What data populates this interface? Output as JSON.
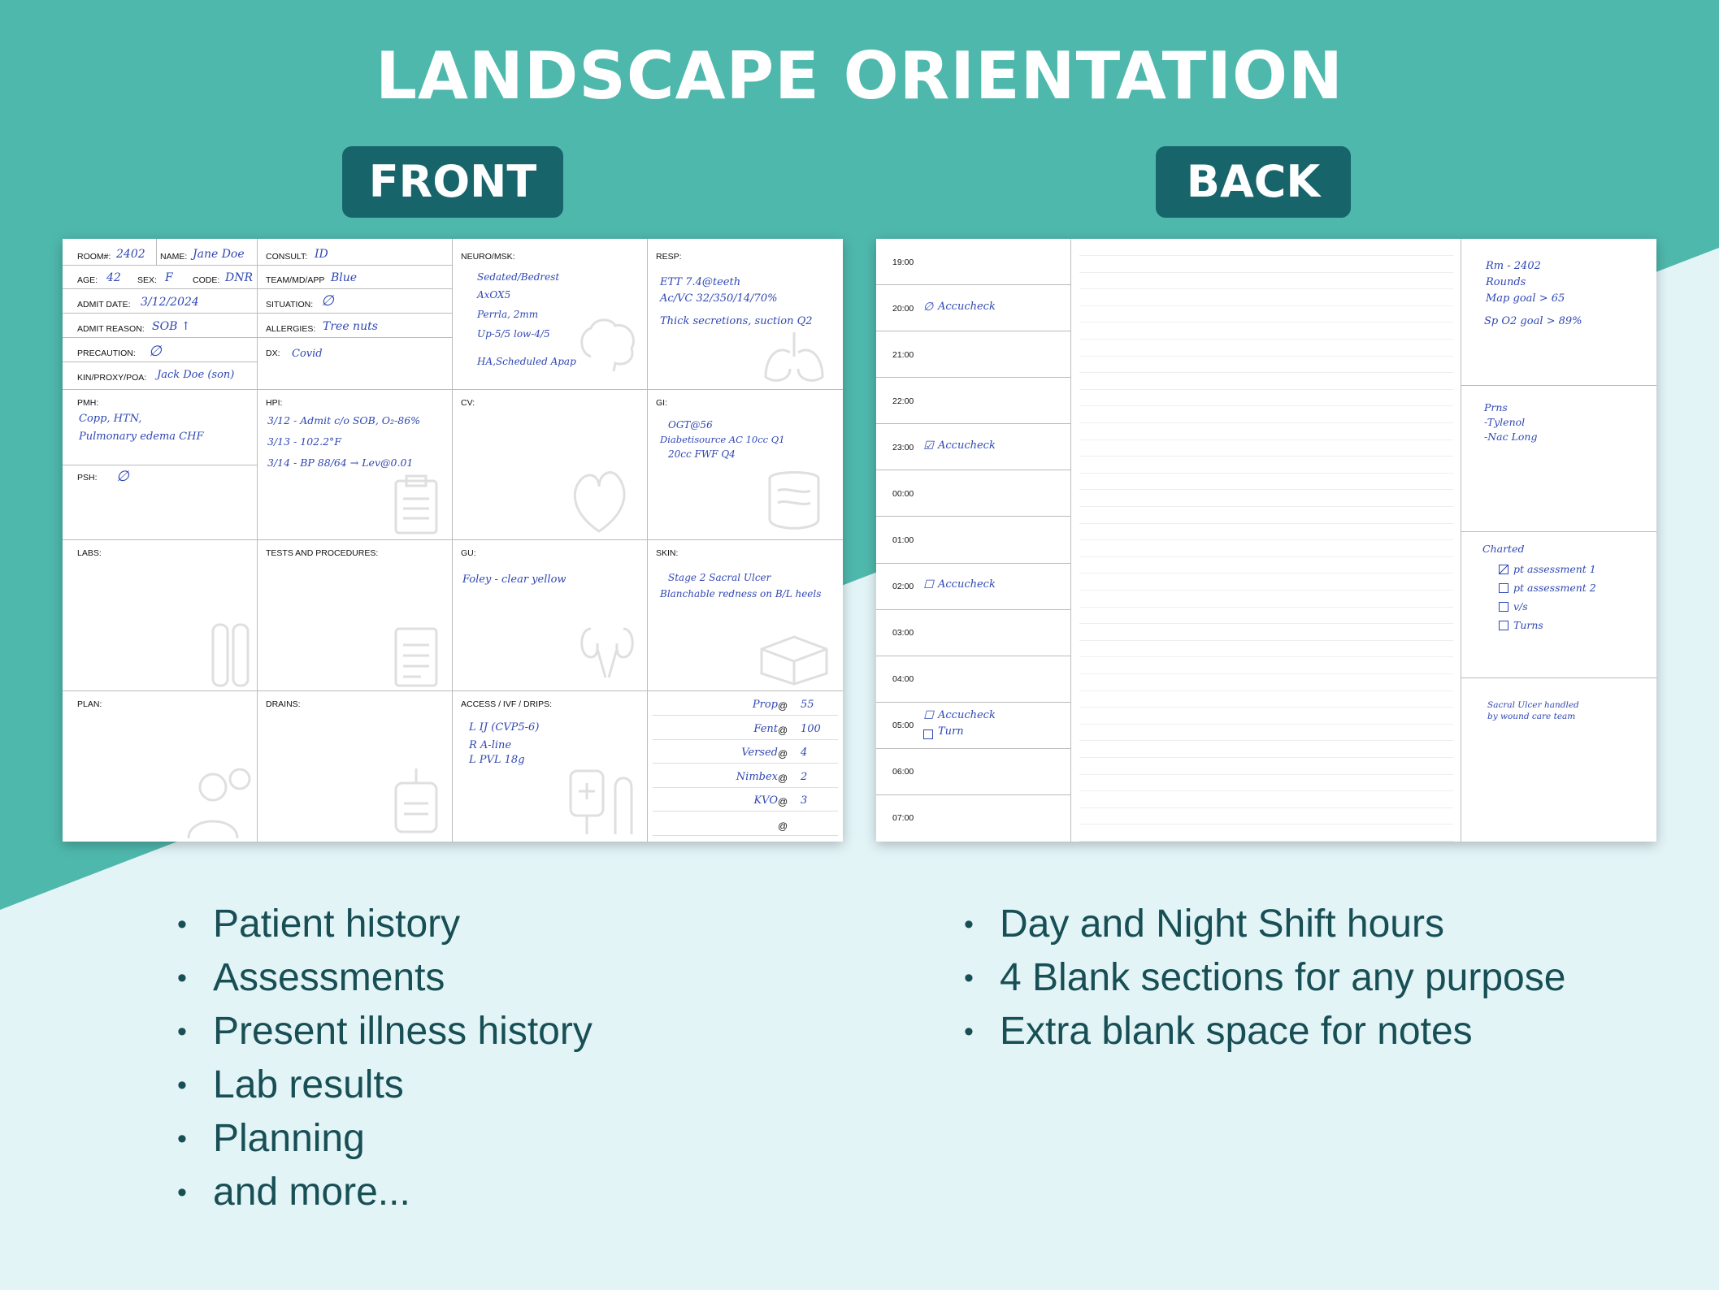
{
  "page": {
    "title": "LANDSCAPE ORIENTATION",
    "front_label": "FRONT",
    "back_label": "BACK",
    "colors": {
      "teal": "#4fb8ad",
      "dark_teal": "#17656b",
      "light_bg": "#e3f4f7",
      "ink": "#2f47b3",
      "bullet_text": "#174f55"
    }
  },
  "front": {
    "room_label": "ROOM#:",
    "room": "2402",
    "name_label": "NAME:",
    "name": "Jane Doe",
    "age_label": "AGE:",
    "age": "42",
    "sex_label": "SEX:",
    "sex": "F",
    "code_label": "CODE:",
    "code": "DNR",
    "admit_date_label": "ADMIT DATE:",
    "admit_date": "3/12/2024",
    "admit_reason_label": "ADMIT REASON:",
    "admit_reason": "SOB ↑",
    "precaution_label": "PRECAUTION:",
    "precaution": "∅",
    "kin_label": "KIN/PROXY/POA:",
    "kin": "Jack Doe (son)",
    "consult_label": "CONSULT:",
    "consult": "ID",
    "team_label": "TEAM/MD/APP",
    "team": "Blue",
    "situation_label": "SITUATION:",
    "situation": "∅",
    "allergies_label": "ALLERGIES:",
    "allergies": "Tree nuts",
    "dx_label": "DX:",
    "dx": "Covid",
    "neuro_label": "NEURO/MSK:",
    "neuro": [
      "Sedated/Bedrest",
      "AxOX5",
      "Perrla, 2mm",
      "Up-5/5  low-4/5",
      "HA,Scheduled Apap"
    ],
    "resp_label": "RESP:",
    "resp": [
      "ETT 7.4@teeth",
      "Ac/VC 32/350/14/70%",
      "Thick secretions, suction Q2"
    ],
    "pmh_label": "PMH:",
    "pmh": [
      "Copp, HTN,",
      "Pulmonary edema     CHF"
    ],
    "psh_label": "PSH:",
    "psh": "∅",
    "hpi_label": "HPI:",
    "hpi": [
      "3/12 - Admit c/o SOB, O₂-86%",
      "3/13 - 102.2°F",
      "3/14 - BP 88/64 → Lev@0.01"
    ],
    "cv_label": "CV:",
    "gi_label": "GI:",
    "gi": [
      "OGT@56",
      "Diabetisource AC 10cc Q1",
      "20cc FWF Q4"
    ],
    "labs_label": "LABS:",
    "tests_label": "TESTS AND PROCEDURES:",
    "gu_label": "GU:",
    "gu": "Foley - clear yellow",
    "skin_label": "SKIN:",
    "skin": [
      "Stage 2 Sacral Ulcer",
      "Blanchable redness on B/L heels"
    ],
    "plan_label": "PLAN:",
    "drains_label": "DRAINS:",
    "access_label": "ACCESS / IVF / DRIPS:",
    "access": [
      "L IJ (CVP5-6)",
      "R A-line",
      "L PVL 18g"
    ],
    "drips": [
      {
        "name": "Prop",
        "at": "@",
        "rate": "55"
      },
      {
        "name": "Fent",
        "at": "@",
        "rate": "100"
      },
      {
        "name": "Versed",
        "at": "@",
        "rate": "4"
      },
      {
        "name": "Nimbex",
        "at": "@",
        "rate": "2"
      },
      {
        "name": "KVO",
        "at": "@",
        "rate": "3"
      },
      {
        "name": "",
        "at": "@",
        "rate": ""
      }
    ]
  },
  "back": {
    "hours": [
      {
        "time": "19:00",
        "note": "",
        "mark": ""
      },
      {
        "time": "20:00",
        "note": "Accucheck",
        "mark": "∅"
      },
      {
        "time": "21:00",
        "note": "",
        "mark": ""
      },
      {
        "time": "22:00",
        "note": "",
        "mark": ""
      },
      {
        "time": "23:00",
        "note": "Accucheck",
        "mark": "☑"
      },
      {
        "time": "00:00",
        "note": "",
        "mark": ""
      },
      {
        "time": "01:00",
        "note": "",
        "mark": ""
      },
      {
        "time": "02:00",
        "note": "Accucheck",
        "mark": "☐"
      },
      {
        "time": "03:00",
        "note": "",
        "mark": ""
      },
      {
        "time": "04:00",
        "note": "",
        "mark": ""
      },
      {
        "time": "05:00",
        "note": "Accucheck",
        "mark": "☐",
        "note2": "Turn"
      },
      {
        "time": "06:00",
        "note": "",
        "mark": ""
      },
      {
        "time": "07:00",
        "note": "",
        "mark": ""
      }
    ],
    "box1": [
      "Rm - 2402",
      "Rounds",
      "Map goal > 65",
      "Sp O2 goal > 89%"
    ],
    "box2": [
      "Prns",
      "-Tylenol",
      "-Nac Long"
    ],
    "box3_title": "Charted",
    "box3": [
      {
        "text": "pt assessment 1",
        "checked": true
      },
      {
        "text": "pt assessment 2",
        "checked": false
      },
      {
        "text": "v/s",
        "checked": false
      },
      {
        "text": "Turns",
        "checked": false
      }
    ],
    "box4": [
      "Sacral Ulcer handled",
      "by wound care team"
    ]
  },
  "features_front": [
    "Patient history",
    "Assessments",
    "Present illness history",
    "Lab results",
    "Planning",
    "and more..."
  ],
  "features_back": [
    "Day and Night Shift hours",
    "4 Blank sections for any purpose",
    "Extra blank space for notes"
  ]
}
